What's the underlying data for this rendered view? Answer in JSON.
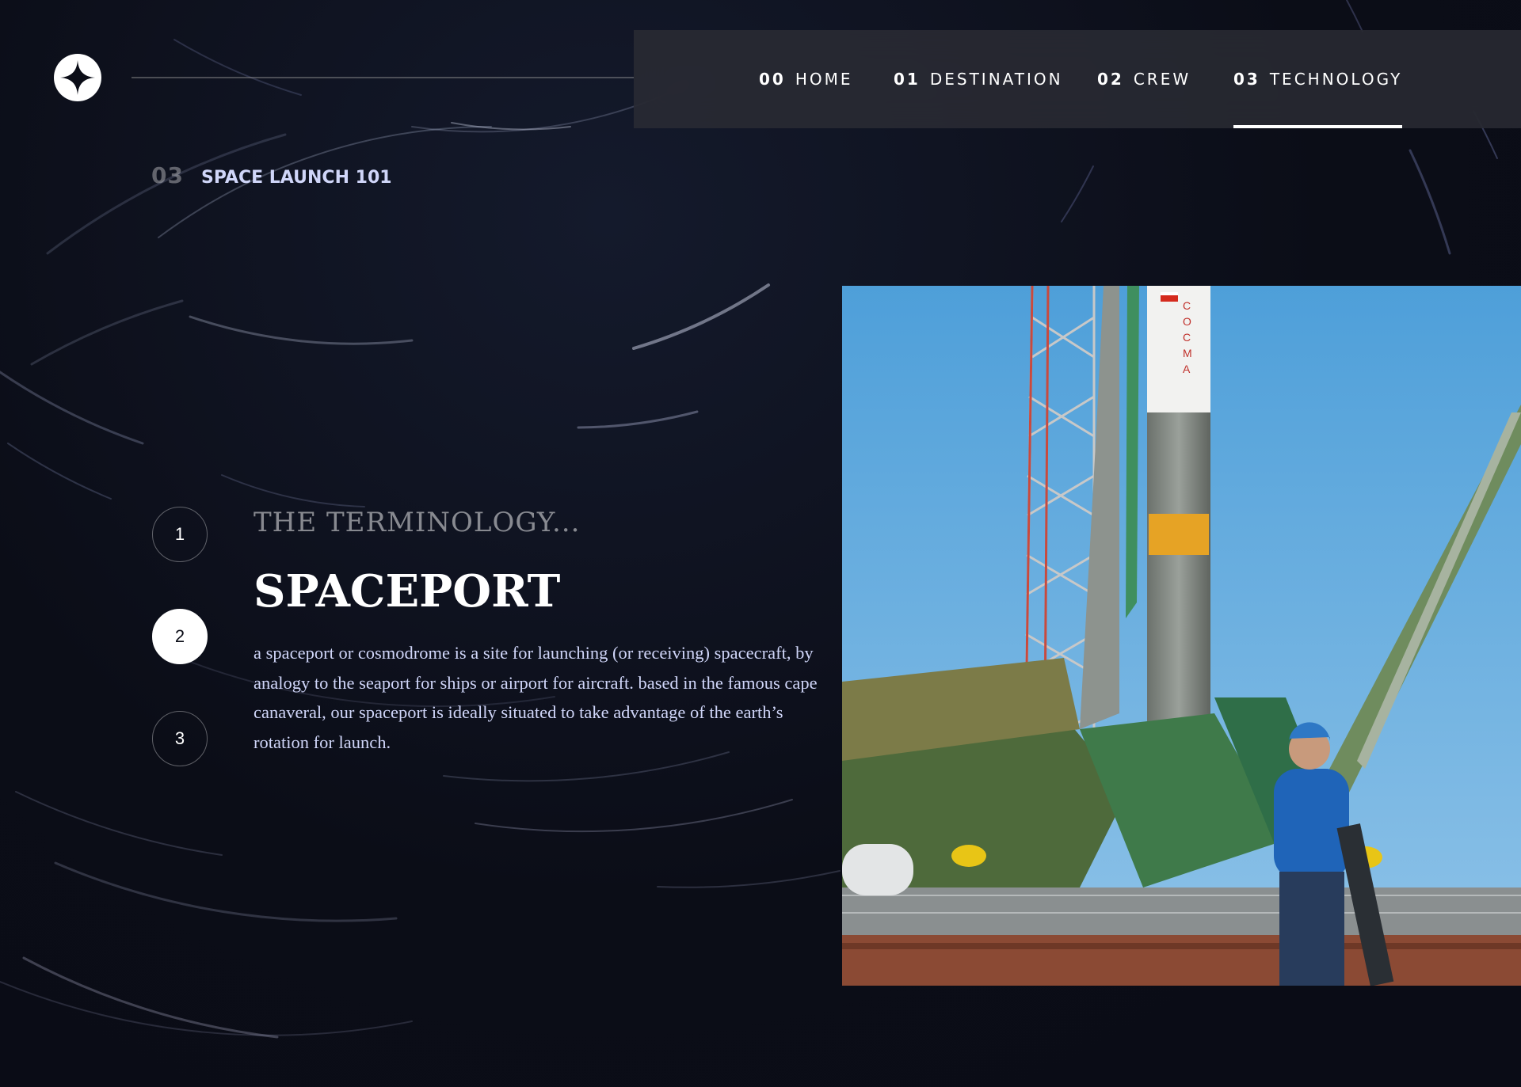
{
  "nav": {
    "items": [
      {
        "num": "00",
        "label": "HOME"
      },
      {
        "num": "01",
        "label": "DESTINATION"
      },
      {
        "num": "02",
        "label": "CREW"
      },
      {
        "num": "03",
        "label": "TECHNOLOGY"
      }
    ],
    "active_index": 3
  },
  "heading": {
    "num": "03",
    "text": "SPACE LAUNCH 101"
  },
  "steps": [
    "1",
    "2",
    "3"
  ],
  "active_step": 1,
  "content": {
    "subheading": "THE TERMINOLOGY...",
    "title": "SPACEPORT",
    "description": "a spaceport or cosmodrome is a site for launching (or receiving) spacecraft, by analogy to the seaport for ships or airport for aircraft. based in the famous cape canaveral, our spaceport is ideally situated to take advantage of the earth’s rotation for launch."
  },
  "icons": {
    "logo": "star-logo-icon"
  },
  "colors": {
    "background": "#0b0d17",
    "accent": "#d0d6f9",
    "white": "#ffffff"
  }
}
